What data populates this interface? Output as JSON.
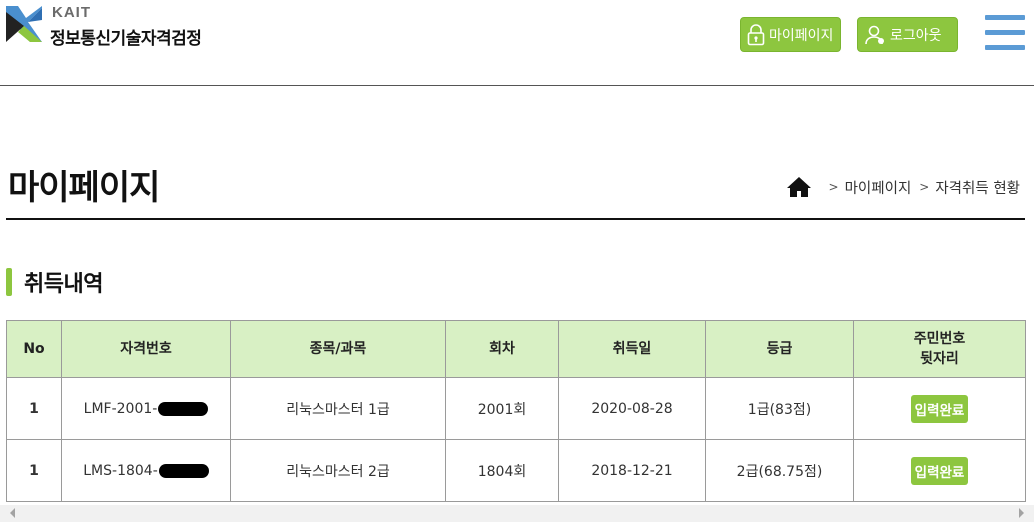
{
  "header": {
    "logo_kait": "KAIT",
    "logo_name": "정보통신기술자격검정",
    "mypage_label": "마이페이지",
    "logout_label": "로그아웃"
  },
  "page": {
    "title": "마이페이지",
    "breadcrumb": [
      "마이페이지",
      "자격취득 현황"
    ],
    "section_title": "취득내역"
  },
  "table": {
    "headers": [
      "No",
      "자격번호",
      "종목/과목",
      "회차",
      "취득일",
      "등급",
      "주민번호\n뒷자리"
    ],
    "rows": [
      {
        "no": "1",
        "cert_prefix": "LMF-2001-",
        "subject": "리눅스마스터 1급",
        "round": "2001회",
        "date": "2020-08-28",
        "grade": "1급(83점)",
        "status": "입력완료"
      },
      {
        "no": "1",
        "cert_prefix": "LMS-1804-",
        "subject": "리눅스마스터 2급",
        "round": "1804회",
        "date": "2018-12-21",
        "grade": "2급(68.75점)",
        "status": "입력완료"
      }
    ]
  },
  "colors": {
    "accent": "#8dc63f",
    "header_bg": "#d8f0c4",
    "menu": "#5b9bd5"
  },
  "icons": [
    "kait-logo",
    "lock-icon",
    "user-icon",
    "hamburger-icon",
    "home-icon",
    "scroll-left-icon",
    "scroll-right-icon"
  ]
}
